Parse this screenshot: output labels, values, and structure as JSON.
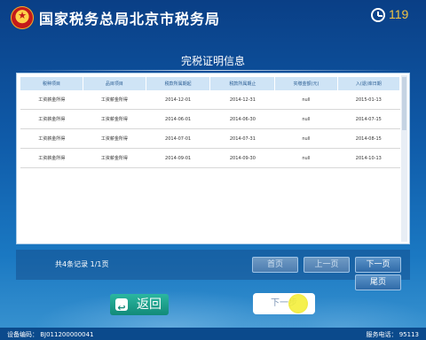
{
  "header": {
    "agency_name": "国家税务总局北京市税务局",
    "countdown": "119"
  },
  "page_title": "完税证明信息",
  "table": {
    "columns": [
      "税种项目",
      "品目项目",
      "税款所属期起",
      "税款所属期止",
      "实缴金额(元)",
      "入(退)库日期"
    ],
    "rows": [
      [
        "工资薪金所得",
        "工资薪金所得",
        "2014-12-01",
        "2014-12-31",
        "null",
        "2015-01-13"
      ],
      [
        "工资薪金所得",
        "工资薪金所得",
        "2014-06-01",
        "2014-06-30",
        "null",
        "2014-07-15"
      ],
      [
        "工资薪金所得",
        "工资薪金所得",
        "2014-07-01",
        "2014-07-31",
        "null",
        "2014-08-15"
      ],
      [
        "工资薪金所得",
        "工资薪金所得",
        "2014-09-01",
        "2014-09-30",
        "null",
        "2014-10-13"
      ]
    ]
  },
  "pagination": {
    "record_info": "共4条记录 1/1页",
    "first_label": "首页",
    "prev_label": "上一页",
    "next_label": "下一页",
    "last_label": "尾页"
  },
  "actions": {
    "back_label": "返回",
    "next_step_label": "下一步"
  },
  "status_bar": {
    "device_code": "设备编码： BJ011200000041",
    "service_phone": "服务电话： 95113"
  }
}
